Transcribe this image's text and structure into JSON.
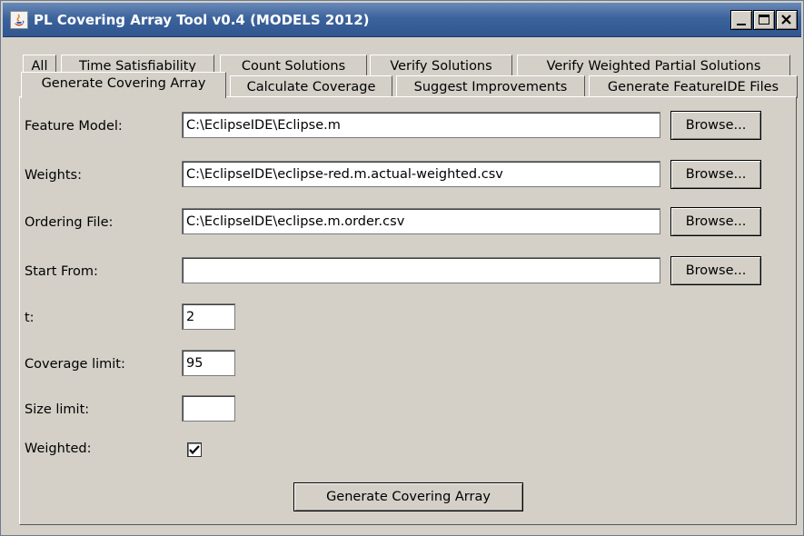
{
  "window": {
    "title": "PL Covering Array Tool v0.4 (MODELS 2012)",
    "controls": [
      "minimize",
      "maximize",
      "close"
    ]
  },
  "tabs": {
    "row1": [
      {
        "label": "All"
      },
      {
        "label": "Time Satisfiability"
      },
      {
        "label": "Count Solutions"
      },
      {
        "label": "Verify Solutions"
      },
      {
        "label": "Verify Weighted Partial Solutions"
      }
    ],
    "row2": [
      {
        "label": "Generate Covering Array",
        "selected": true
      },
      {
        "label": "Calculate Coverage"
      },
      {
        "label": "Suggest Improvements"
      },
      {
        "label": "Generate FeatureIDE Files"
      }
    ]
  },
  "form": {
    "feature_model": {
      "label": "Feature Model:",
      "value": "C:\\EclipseIDE\\Eclipse.m",
      "browse": "Browse..."
    },
    "weights": {
      "label": "Weights:",
      "value": "C:\\EclipseIDE\\eclipse-red.m.actual-weighted.csv",
      "browse": "Browse..."
    },
    "ordering_file": {
      "label": "Ordering File:",
      "value": "C:\\EclipseIDE\\eclipse.m.order.csv",
      "browse": "Browse..."
    },
    "start_from": {
      "label": "Start From:",
      "value": "",
      "browse": "Browse..."
    },
    "t": {
      "label": "t:",
      "value": "2"
    },
    "coverage_limit": {
      "label": "Coverage limit:",
      "value": "95"
    },
    "size_limit": {
      "label": "Size limit:",
      "value": ""
    },
    "weighted": {
      "label": "Weighted:",
      "checked": true
    }
  },
  "actions": {
    "generate": "Generate Covering Array"
  },
  "colors": {
    "titlebar": "#3d639c",
    "window_bg": "#d4d0c8",
    "title_text": "#ffffff"
  }
}
